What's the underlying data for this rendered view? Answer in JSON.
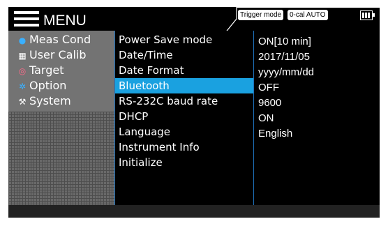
{
  "header": {
    "menu_label": "MENU",
    "badges": [
      "Trigger mode",
      "0-cal AUTO"
    ]
  },
  "sidebar": {
    "items": [
      {
        "label": "Meas Cond",
        "icon": "measurement-icon",
        "icon_color": "#3ab0ff"
      },
      {
        "label": "User Calib",
        "icon": "calibration-icon",
        "icon_color": "#ffffff"
      },
      {
        "label": "Target",
        "icon": "target-icon",
        "icon_color": "#ff6a8a"
      },
      {
        "label": "Option",
        "icon": "gear-icon",
        "icon_color": "#3ab0ff"
      },
      {
        "label": "System",
        "icon": "tools-icon",
        "icon_color": "#ffffff"
      }
    ]
  },
  "settings": {
    "rows": [
      {
        "name": "Power Save mode",
        "value": "ON[10 min]"
      },
      {
        "name": "Date/Time",
        "value": "2017/11/05"
      },
      {
        "name": "Date Format",
        "value": "yyyy/mm/dd"
      },
      {
        "name": "Bluetooth",
        "value": "OFF",
        "selected": true
      },
      {
        "name": "RS-232C baud rate",
        "value": "9600"
      },
      {
        "name": "DHCP",
        "value": "ON"
      },
      {
        "name": "Language",
        "value": "English"
      },
      {
        "name": "Instrument Info",
        "value": ""
      },
      {
        "name": "Initialize",
        "value": ""
      }
    ]
  },
  "colors": {
    "highlight": "#1aa1e0",
    "divider": "#1e6fb8"
  }
}
